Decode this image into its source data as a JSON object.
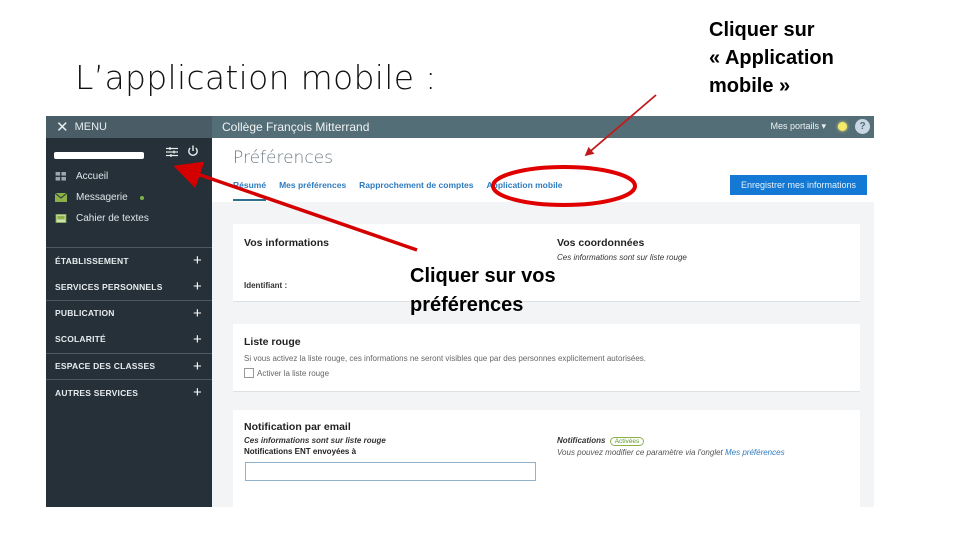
{
  "slide": {
    "title": "L’application mobile :",
    "callout_top": [
      "Cliquer sur",
      "« Application",
      "mobile »"
    ],
    "callout_mid": [
      "Cliquer sur vos",
      "préférences"
    ]
  },
  "sidebar": {
    "menu_label": "MENU",
    "nav": [
      {
        "label": "Accueil",
        "icon": "grid-icon"
      },
      {
        "label": "Messagerie",
        "icon": "envelope-icon",
        "badge": true
      },
      {
        "label": "Cahier de textes",
        "icon": "notebook-icon"
      }
    ],
    "sections": [
      {
        "label": "ÉTABLISSEMENT"
      },
      {
        "label": "SERVICES PERSONNELS"
      },
      {
        "label": "PUBLICATION"
      },
      {
        "label": "SCOLARITÉ"
      },
      {
        "label": "ESPACE DES CLASSES"
      },
      {
        "label": "AUTRES SERVICES"
      }
    ]
  },
  "topbar": {
    "school": "Collège François Mitterrand",
    "portails": "Mes portails ▾",
    "help": "?"
  },
  "page": {
    "title": "Préférences",
    "tabs": [
      {
        "label": "Résumé",
        "active": true
      },
      {
        "label": "Mes préférences"
      },
      {
        "label": "Rapprochement de comptes"
      },
      {
        "label": "Application mobile"
      }
    ],
    "save_button": "Enregistrer mes informations"
  },
  "cards": {
    "infos": {
      "title": "Vos informations",
      "identifiant_label": "Identifiant :",
      "coord_title": "Vos coordonnées",
      "coord_note": "Ces informations sont sur liste rouge"
    },
    "liste_rouge": {
      "title": "Liste rouge",
      "description": "Si vous activez la liste rouge, ces informations ne seront visibles que par des personnes explicitement autorisées.",
      "checkbox_label": "Activer la liste rouge",
      "checked": false
    },
    "notification": {
      "title": "Notification par email",
      "note": "Ces informations sont sur liste rouge",
      "sent_label": "Notifications ENT envoyées à",
      "email_value": "",
      "notif_label": "Notifications",
      "notif_status": "Activées",
      "notif_help": "Vous pouvez modifier ce paramètre via l'onglet",
      "notif_link": "Mes préférences"
    }
  },
  "colors": {
    "sidebar_bg": "#253038",
    "topbar_bg": "#546e78",
    "accent_blue": "#1479d4",
    "link_blue": "#2f7bbf",
    "annotation_red": "#e00000"
  }
}
